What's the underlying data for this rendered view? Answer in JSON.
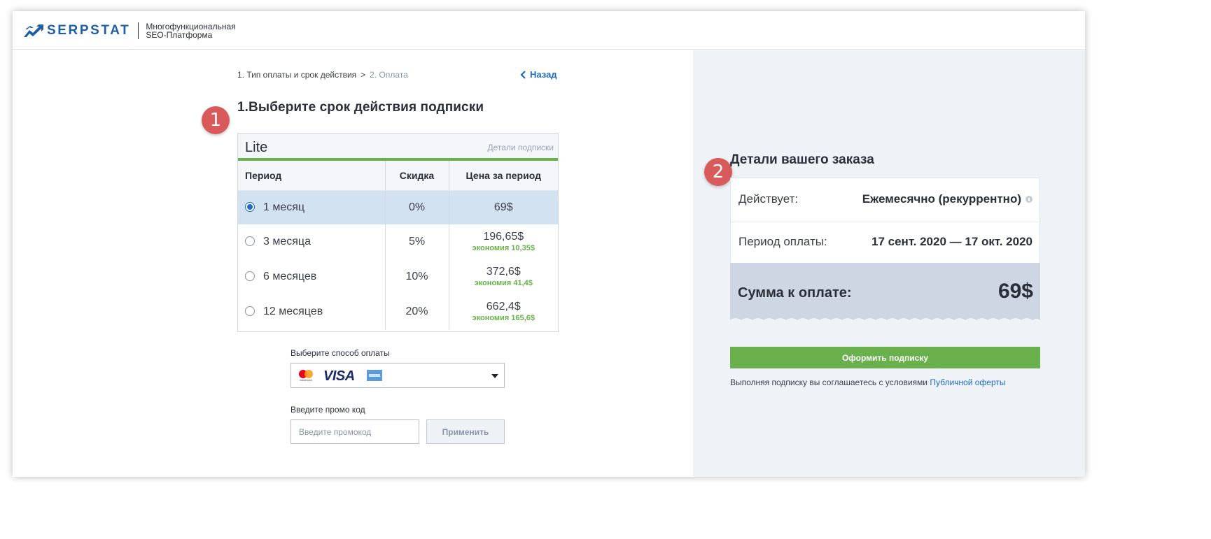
{
  "header": {
    "brand": "SERPSTAT",
    "tagline_line1": "Многофункциональная",
    "tagline_line2": "SEO-Платформа"
  },
  "breadcrumb": {
    "step1": "1. Тип оплаты и срок действия",
    "separator": ">",
    "step2": "2. Оплата",
    "back_label": "Назад"
  },
  "section1": {
    "badge": "1",
    "title": "1.Выберите срок действия подписки"
  },
  "plan": {
    "name": "Lite",
    "details_link": "Детали подписки",
    "columns": [
      "Период",
      "Скидка",
      "Цена за период"
    ],
    "rows": [
      {
        "period": "1 месяц",
        "discount": "0%",
        "price": "69$",
        "saving": "",
        "selected": true
      },
      {
        "period": "3 месяца",
        "discount": "5%",
        "price": "196,65$",
        "saving": "экономия 10,35$",
        "selected": false
      },
      {
        "period": "6 месяцев",
        "discount": "10%",
        "price": "372,6$",
        "saving": "экономия 41,4$",
        "selected": false
      },
      {
        "period": "12 месяцев",
        "discount": "20%",
        "price": "662,4$",
        "saving": "экономия 165,6$",
        "selected": false
      }
    ]
  },
  "payment": {
    "label": "Выберите способ оплаты",
    "visa_text": "VISA",
    "mastercard_caption": "mastercard",
    "promo_label": "Введите промо код",
    "promo_placeholder": "Введите промокод",
    "apply_label": "Применить"
  },
  "section2": {
    "badge": "2",
    "title": "Детали вашего заказа"
  },
  "order": {
    "valid_label": "Действует:",
    "valid_value": "Ежемесячно (рекуррентно)",
    "period_label": "Период оплаты:",
    "period_value": "17 сент. 2020 — 17 окт. 2020",
    "total_label": "Сумма к оплате:",
    "total_value": "69$"
  },
  "actions": {
    "subscribe_label": "Оформить подписку",
    "agree_text": "Выполняя подписку вы соглашаетесь с условиями",
    "agree_link": "Публичной оферты"
  },
  "colors": {
    "brand_blue": "#1f5fa8",
    "link_blue": "#1f6bbf",
    "accent_green": "#6ab04c",
    "badge_red": "#d95a5a",
    "selected_row": "#d3e2f1",
    "panel_bg": "#eff2f7",
    "total_bg": "#cdd6e2"
  }
}
